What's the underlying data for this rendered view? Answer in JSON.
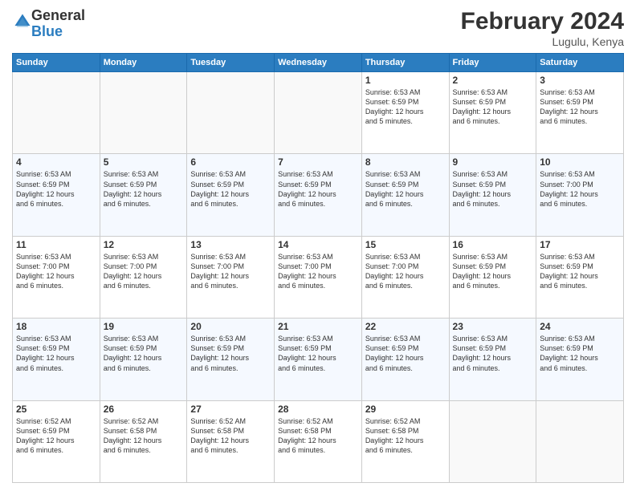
{
  "logo": {
    "general": "General",
    "blue": "Blue"
  },
  "title": "February 2024",
  "subtitle": "Lugulu, Kenya",
  "days_of_week": [
    "Sunday",
    "Monday",
    "Tuesday",
    "Wednesday",
    "Thursday",
    "Friday",
    "Saturday"
  ],
  "weeks": [
    [
      {
        "day": "",
        "info": ""
      },
      {
        "day": "",
        "info": ""
      },
      {
        "day": "",
        "info": ""
      },
      {
        "day": "",
        "info": ""
      },
      {
        "day": "1",
        "info": "Sunrise: 6:53 AM\nSunset: 6:59 PM\nDaylight: 12 hours\nand 5 minutes."
      },
      {
        "day": "2",
        "info": "Sunrise: 6:53 AM\nSunset: 6:59 PM\nDaylight: 12 hours\nand 6 minutes."
      },
      {
        "day": "3",
        "info": "Sunrise: 6:53 AM\nSunset: 6:59 PM\nDaylight: 12 hours\nand 6 minutes."
      }
    ],
    [
      {
        "day": "4",
        "info": "Sunrise: 6:53 AM\nSunset: 6:59 PM\nDaylight: 12 hours\nand 6 minutes."
      },
      {
        "day": "5",
        "info": "Sunrise: 6:53 AM\nSunset: 6:59 PM\nDaylight: 12 hours\nand 6 minutes."
      },
      {
        "day": "6",
        "info": "Sunrise: 6:53 AM\nSunset: 6:59 PM\nDaylight: 12 hours\nand 6 minutes."
      },
      {
        "day": "7",
        "info": "Sunrise: 6:53 AM\nSunset: 6:59 PM\nDaylight: 12 hours\nand 6 minutes."
      },
      {
        "day": "8",
        "info": "Sunrise: 6:53 AM\nSunset: 6:59 PM\nDaylight: 12 hours\nand 6 minutes."
      },
      {
        "day": "9",
        "info": "Sunrise: 6:53 AM\nSunset: 6:59 PM\nDaylight: 12 hours\nand 6 minutes."
      },
      {
        "day": "10",
        "info": "Sunrise: 6:53 AM\nSunset: 7:00 PM\nDaylight: 12 hours\nand 6 minutes."
      }
    ],
    [
      {
        "day": "11",
        "info": "Sunrise: 6:53 AM\nSunset: 7:00 PM\nDaylight: 12 hours\nand 6 minutes."
      },
      {
        "day": "12",
        "info": "Sunrise: 6:53 AM\nSunset: 7:00 PM\nDaylight: 12 hours\nand 6 minutes."
      },
      {
        "day": "13",
        "info": "Sunrise: 6:53 AM\nSunset: 7:00 PM\nDaylight: 12 hours\nand 6 minutes."
      },
      {
        "day": "14",
        "info": "Sunrise: 6:53 AM\nSunset: 7:00 PM\nDaylight: 12 hours\nand 6 minutes."
      },
      {
        "day": "15",
        "info": "Sunrise: 6:53 AM\nSunset: 7:00 PM\nDaylight: 12 hours\nand 6 minutes."
      },
      {
        "day": "16",
        "info": "Sunrise: 6:53 AM\nSunset: 6:59 PM\nDaylight: 12 hours\nand 6 minutes."
      },
      {
        "day": "17",
        "info": "Sunrise: 6:53 AM\nSunset: 6:59 PM\nDaylight: 12 hours\nand 6 minutes."
      }
    ],
    [
      {
        "day": "18",
        "info": "Sunrise: 6:53 AM\nSunset: 6:59 PM\nDaylight: 12 hours\nand 6 minutes."
      },
      {
        "day": "19",
        "info": "Sunrise: 6:53 AM\nSunset: 6:59 PM\nDaylight: 12 hours\nand 6 minutes."
      },
      {
        "day": "20",
        "info": "Sunrise: 6:53 AM\nSunset: 6:59 PM\nDaylight: 12 hours\nand 6 minutes."
      },
      {
        "day": "21",
        "info": "Sunrise: 6:53 AM\nSunset: 6:59 PM\nDaylight: 12 hours\nand 6 minutes."
      },
      {
        "day": "22",
        "info": "Sunrise: 6:53 AM\nSunset: 6:59 PM\nDaylight: 12 hours\nand 6 minutes."
      },
      {
        "day": "23",
        "info": "Sunrise: 6:53 AM\nSunset: 6:59 PM\nDaylight: 12 hours\nand 6 minutes."
      },
      {
        "day": "24",
        "info": "Sunrise: 6:53 AM\nSunset: 6:59 PM\nDaylight: 12 hours\nand 6 minutes."
      }
    ],
    [
      {
        "day": "25",
        "info": "Sunrise: 6:52 AM\nSunset: 6:59 PM\nDaylight: 12 hours\nand 6 minutes."
      },
      {
        "day": "26",
        "info": "Sunrise: 6:52 AM\nSunset: 6:58 PM\nDaylight: 12 hours\nand 6 minutes."
      },
      {
        "day": "27",
        "info": "Sunrise: 6:52 AM\nSunset: 6:58 PM\nDaylight: 12 hours\nand 6 minutes."
      },
      {
        "day": "28",
        "info": "Sunrise: 6:52 AM\nSunset: 6:58 PM\nDaylight: 12 hours\nand 6 minutes."
      },
      {
        "day": "29",
        "info": "Sunrise: 6:52 AM\nSunset: 6:58 PM\nDaylight: 12 hours\nand 6 minutes."
      },
      {
        "day": "",
        "info": ""
      },
      {
        "day": "",
        "info": ""
      }
    ]
  ]
}
